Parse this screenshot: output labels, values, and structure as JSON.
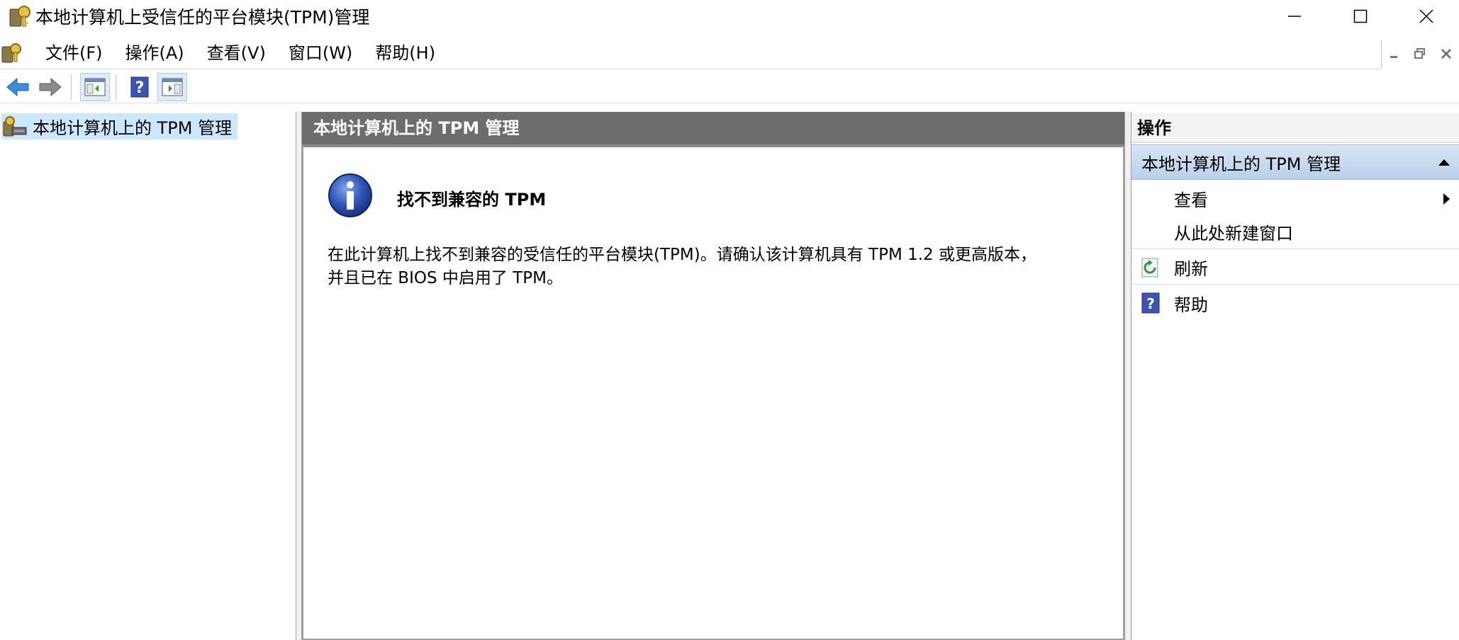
{
  "window": {
    "title": "本地计算机上受信任的平台模块(TPM)管理"
  },
  "menu": {
    "items": [
      "文件(F)",
      "操作(A)",
      "查看(V)",
      "窗口(W)",
      "帮助(H)"
    ]
  },
  "tree": {
    "root_label": "本地计算机上的 TPM 管理"
  },
  "center": {
    "header": "本地计算机上的 TPM 管理",
    "message_title": "找不到兼容的 TPM",
    "message_line1": "在此计算机上找不到兼容的受信任的平台模块(TPM)。请确认该计算机具有 TPM 1.2 或更高版本，",
    "message_line2": "并且已在 BIOS 中启用了 TPM。"
  },
  "actions": {
    "header": "操作",
    "group_label": "本地计算机上的 TPM 管理",
    "items": [
      {
        "label": "查看",
        "icon": "none",
        "submenu": true
      },
      {
        "label": "从此处新建窗口",
        "icon": "none"
      },
      {
        "label": "刷新",
        "icon": "refresh-icon"
      },
      {
        "label": "帮助",
        "icon": "help-icon"
      }
    ]
  },
  "colors": {
    "center_header_bg": "#6d6d6d",
    "tree_selected_bg": "#cce8ff",
    "actions_group_bg": "#c7dbef"
  }
}
